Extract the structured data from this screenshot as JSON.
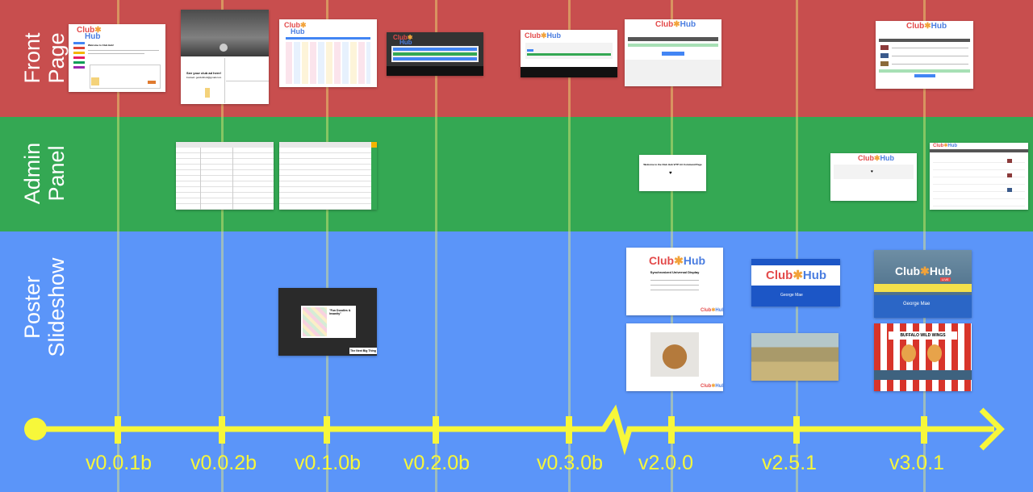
{
  "rows": {
    "front_page": "Front\nPage",
    "admin_panel": "Admin\nPanel",
    "poster_slideshow": "Poster\nSlideshow"
  },
  "versions": [
    "v0.0.1b",
    "v0.0.2b",
    "v0.1.0b",
    "v0.2.0b",
    "v0.3.0b",
    "v2.0.0",
    "v2.5.1",
    "v3.0.1"
  ],
  "logo": {
    "club": "Club",
    "hub": "Hub",
    "star": "✱"
  },
  "thumbnail_text": {
    "welcome": "Welcome to Club Hub!",
    "see_club_ad": "See your club ad here!",
    "contact": "Contact: getclubhub@gmail.com",
    "doodles": "\"Fun Doodles &\nInsanity\"",
    "next_big_thing": "The Next Big Thing",
    "sync_display": "Synchronized Universal Display",
    "welcome_admin": "Welcome to the Club Hub ViTP Art Command Page",
    "george_mae": "George Mae",
    "buffalo_wild_wings": "BUFFALO WILD WINGS",
    "live": "LIVE"
  },
  "colors": {
    "front": "#c84e4e",
    "admin": "#34a853",
    "poster": "#5b95f9",
    "timeline": "#f7f73a"
  }
}
